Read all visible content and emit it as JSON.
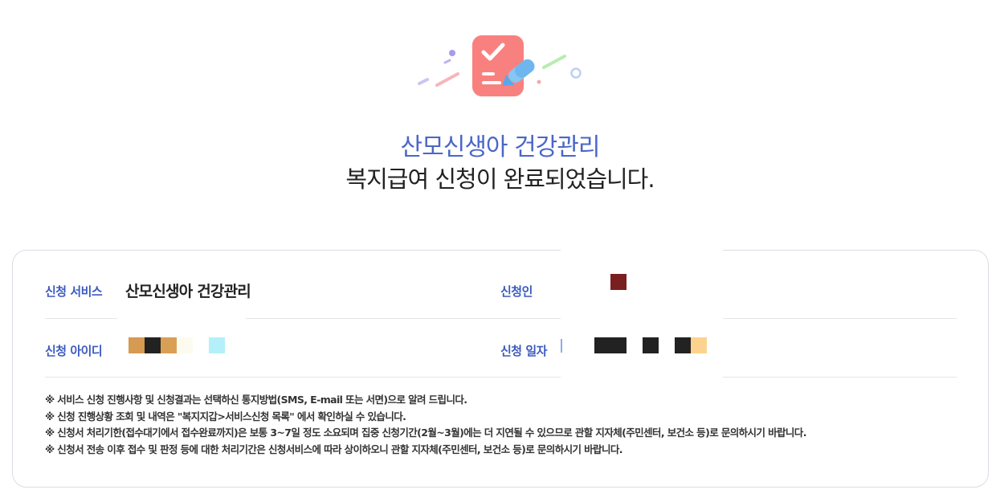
{
  "result": {
    "service_title": "산모신생아 건강관리",
    "complete_message": "복지급여 신청이 완료되었습니다."
  },
  "details": {
    "service_label": "신청 서비스",
    "service_value": "산모신생아 건강관리",
    "applicant_label": "신청인",
    "id_label": "신청 아이디",
    "date_label": "신청 일자"
  },
  "notices": [
    "※ 서비스 신청 진행사항 및 신청결과는 선택하신 통지방법(SMS, E-mail 또는 서면)으로 알려 드립니다.",
    "※ 신청 진행상황 조회 및 내역은 \"복지지갑>서비스신청 목록\" 에서 확인하실 수 있습니다.",
    "※ 신청서 처리기한(접수대기에서 접수완료까지)은 보통 3~7일 정도 소요되며 집중 신청기간(2월~3월)에는 더 지연될 수 있으므로 관할 지자체(주민센터, 보건소 등)로 문의하시기 바랍니다.",
    "※ 신청서 전송 이후 접수 및 판정 등에 대한 처리기간은 신청서비스에 따라 상이하오니 관할 지자체(주민센터, 보건소 등)로 문의하시기 바랍니다."
  ],
  "colors": {
    "accent": "#4a66c6",
    "icon_red": "#f36b6b",
    "icon_blue": "#6fb6ef"
  }
}
